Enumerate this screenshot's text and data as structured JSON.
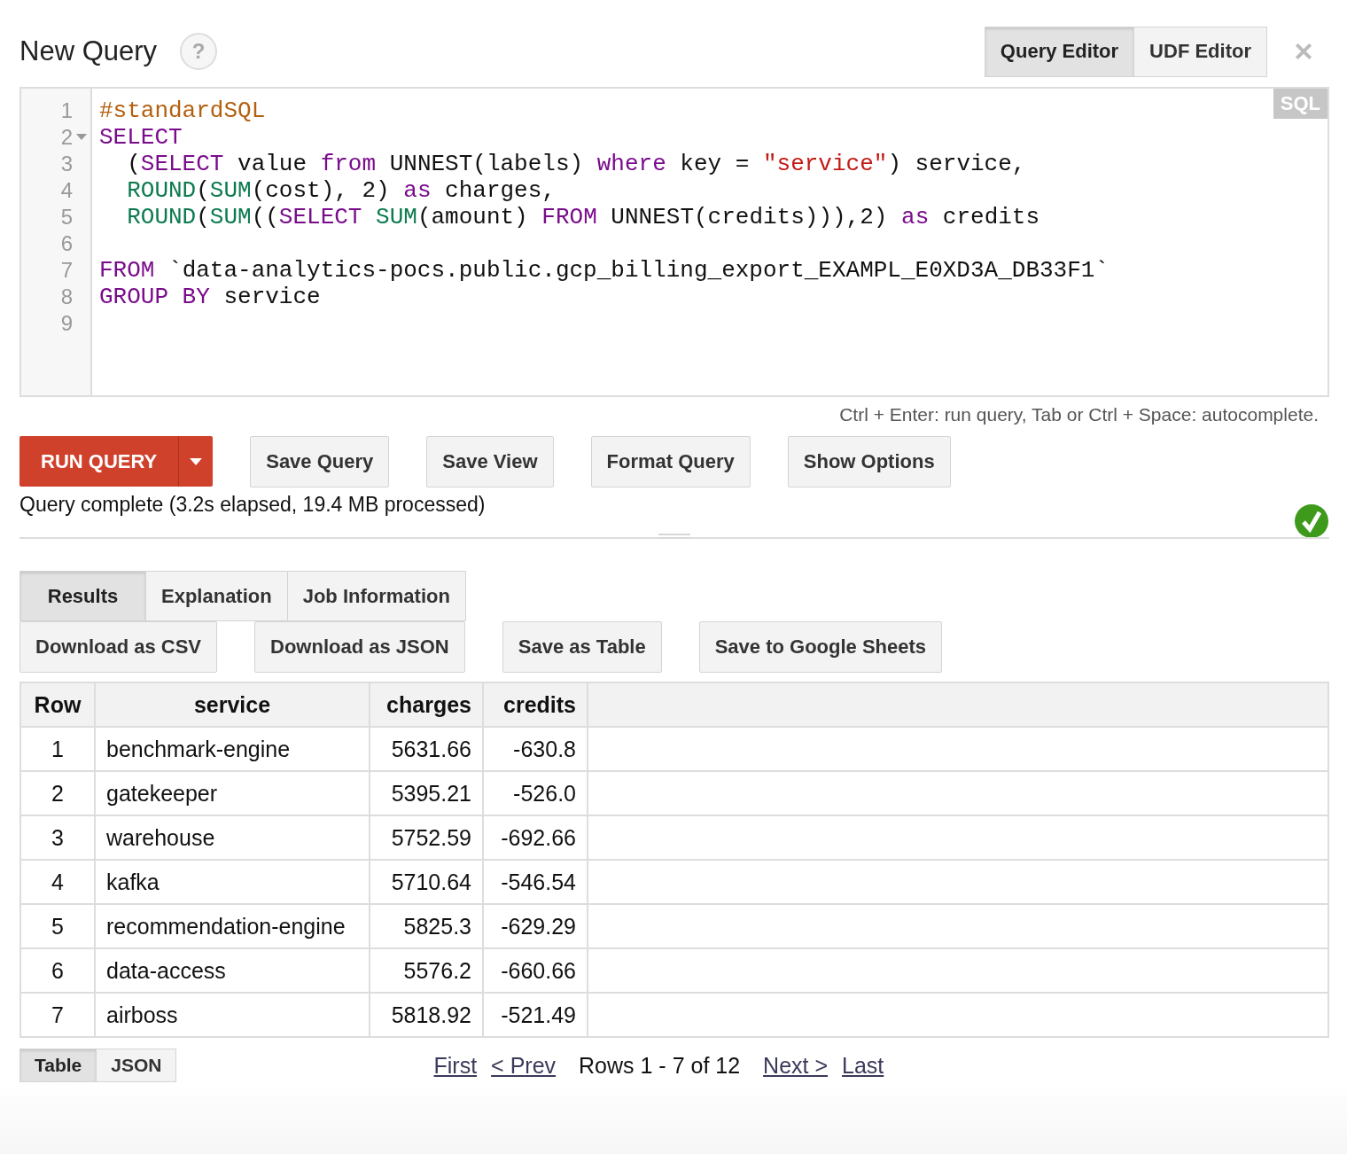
{
  "header": {
    "title": "New Query",
    "help": "?",
    "editor_tabs": [
      {
        "label": "Query Editor",
        "selected": true
      },
      {
        "label": "UDF Editor",
        "selected": false
      }
    ]
  },
  "editor": {
    "badge": "SQL",
    "lines": [
      {
        "number": "1",
        "foldable": false,
        "tokens": [
          {
            "kind": "meta",
            "text": "#standardSQL"
          }
        ]
      },
      {
        "number": "2",
        "foldable": true,
        "tokens": [
          {
            "kind": "kw",
            "text": "SELECT"
          }
        ]
      },
      {
        "number": "3",
        "foldable": false,
        "tokens": [
          {
            "kind": "plain",
            "text": "  ("
          },
          {
            "kind": "kw",
            "text": "SELECT"
          },
          {
            "kind": "plain",
            "text": " value "
          },
          {
            "kind": "kw",
            "text": "from"
          },
          {
            "kind": "plain",
            "text": " UNNEST(labels) "
          },
          {
            "kind": "kw",
            "text": "where"
          },
          {
            "kind": "plain",
            "text": " key = "
          },
          {
            "kind": "str",
            "text": "\"service\""
          },
          {
            "kind": "plain",
            "text": ") service,"
          }
        ]
      },
      {
        "number": "4",
        "foldable": false,
        "tokens": [
          {
            "kind": "fn",
            "text": "  ROUND"
          },
          {
            "kind": "plain",
            "text": "("
          },
          {
            "kind": "fn",
            "text": "SUM"
          },
          {
            "kind": "plain",
            "text": "(cost), 2) "
          },
          {
            "kind": "kw",
            "text": "as"
          },
          {
            "kind": "plain",
            "text": " charges,"
          }
        ]
      },
      {
        "number": "5",
        "foldable": false,
        "tokens": [
          {
            "kind": "fn",
            "text": "  ROUND"
          },
          {
            "kind": "plain",
            "text": "("
          },
          {
            "kind": "fn",
            "text": "SUM"
          },
          {
            "kind": "plain",
            "text": "(("
          },
          {
            "kind": "kw",
            "text": "SELECT"
          },
          {
            "kind": "fn",
            "text": " SUM"
          },
          {
            "kind": "plain",
            "text": "(amount) "
          },
          {
            "kind": "kw",
            "text": "FROM"
          },
          {
            "kind": "plain",
            "text": " UNNEST(credits))),2) "
          },
          {
            "kind": "kw",
            "text": "as"
          },
          {
            "kind": "plain",
            "text": " credits"
          }
        ]
      },
      {
        "number": "6",
        "foldable": false
      },
      {
        "number": "7",
        "foldable": false,
        "tokens": [
          {
            "kind": "kw",
            "text": "FROM"
          },
          {
            "kind": "plain",
            "text": " `data-analytics-pocs.public.gcp_billing_export_EXAMPL_E0XD3A_DB33F1`"
          }
        ]
      },
      {
        "number": "8",
        "foldable": false,
        "tokens": [
          {
            "kind": "kw",
            "text": "GROUP"
          },
          {
            "kind": "kw",
            "text": " BY"
          },
          {
            "kind": "plain",
            "text": " service"
          }
        ]
      },
      {
        "number": "9",
        "foldable": false
      }
    ],
    "hint": "Ctrl + Enter: run query, Tab or Ctrl + Space: autocomplete."
  },
  "actions": {
    "run": "RUN QUERY",
    "buttons": [
      "Save Query",
      "Save View",
      "Format Query",
      "Show Options"
    ]
  },
  "status": {
    "text": "Query complete (3.2s elapsed, 19.4 MB processed)",
    "success": true
  },
  "result_tabs": [
    {
      "label": "Results",
      "selected": true
    },
    {
      "label": "Explanation",
      "selected": false
    },
    {
      "label": "Job Information",
      "selected": false
    }
  ],
  "export_buttons": [
    "Download as CSV",
    "Download as JSON",
    "Save as Table",
    "Save to Google Sheets"
  ],
  "table": {
    "columns": [
      "Row",
      "service",
      "charges",
      "credits"
    ],
    "rows": [
      [
        "1",
        "benchmark-engine",
        "5631.66",
        "-630.8"
      ],
      [
        "2",
        "gatekeeper",
        "5395.21",
        "-526.0"
      ],
      [
        "3",
        "warehouse",
        "5752.59",
        "-692.66"
      ],
      [
        "4",
        "kafka",
        "5710.64",
        "-546.54"
      ],
      [
        "5",
        "recommendation-engine",
        "5825.3",
        "-629.29"
      ],
      [
        "6",
        "data-access",
        "5576.2",
        "-660.66"
      ],
      [
        "7",
        "airboss",
        "5818.92",
        "-521.49"
      ]
    ]
  },
  "view_tabs": [
    {
      "label": "Table",
      "selected": true
    },
    {
      "label": "JSON",
      "selected": false
    }
  ],
  "pager": {
    "first": "First",
    "prev": "< Prev",
    "summary": "Rows 1 - 7 of 12",
    "next": "Next >",
    "last": "Last"
  }
}
